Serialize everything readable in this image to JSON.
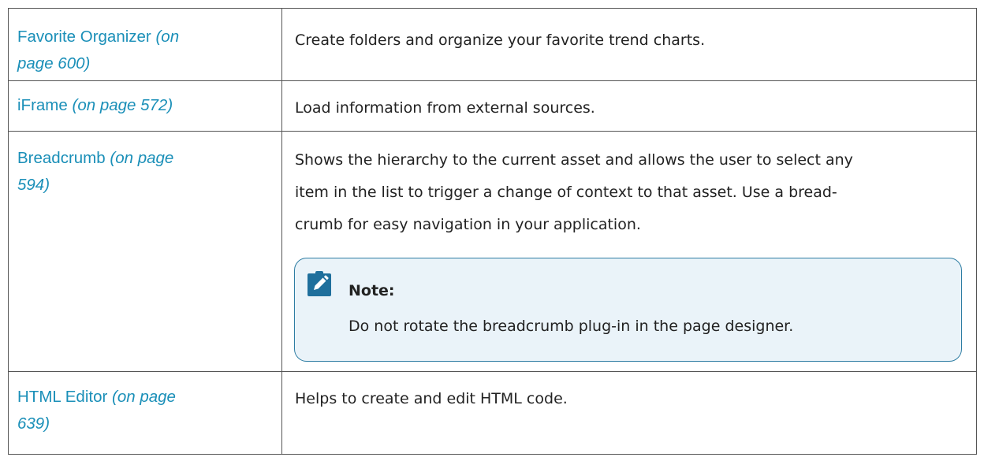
{
  "rows": [
    {
      "name": "Favorite Organizer",
      "ref": "(on page 600)",
      "ref_line1": "(on",
      "ref_line2": "page 600)",
      "description": [
        "Create folders and organize your favorite trend charts."
      ]
    },
    {
      "name": "iFrame",
      "ref": "(on page 572)",
      "description": [
        "Load information from external sources."
      ]
    },
    {
      "name": "Breadcrumb",
      "ref_line1": "(on page",
      "ref_line2": "594)",
      "description": [
        "Shows the hierarchy to the current asset and allows the user to select any",
        "item in the list to trigger a change of context to that asset. Use a bread-",
        "crumb for easy navigation in your application."
      ],
      "note": {
        "icon": "pencil-note-icon",
        "title": "Note:",
        "text": "Do not rotate the breadcrumb plug-in in the page designer."
      }
    },
    {
      "name": "HTML Editor",
      "ref_line1": "(on page",
      "ref_line2": "639)",
      "description": [
        "Helps to create and edit HTML code."
      ]
    }
  ],
  "colors": {
    "link": "#1a8fb8",
    "text": "#222222",
    "border": "#555555",
    "note_border": "#2e7da3",
    "note_background": "#eaf3f9",
    "note_icon": "#1f6f9c"
  }
}
